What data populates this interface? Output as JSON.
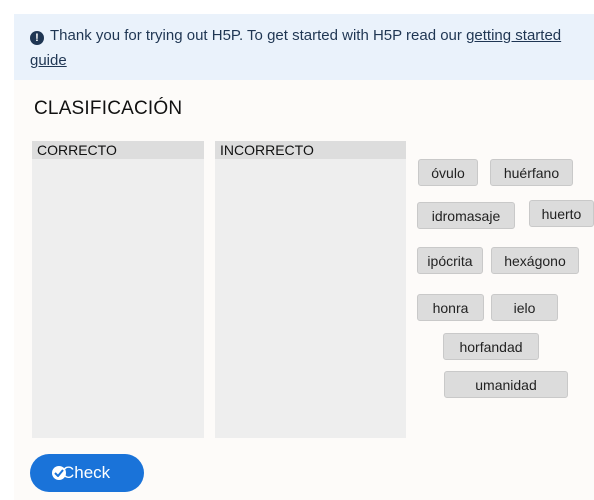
{
  "notice": {
    "text_before": "Thank you for trying out H5P. To get started with H5P read our ",
    "link_text": "getting started guide"
  },
  "task": {
    "title": "CLASIFICACIÓN",
    "zones": [
      "CORRECTO",
      "INCORRECTO"
    ],
    "draggables": [
      "óvulo",
      "huérfano",
      "idromasaje",
      "huerto",
      "ipócrita",
      "hexágono",
      "honra",
      "ielo",
      "horfandad",
      "umanidad"
    ]
  },
  "actions": {
    "check_label": "Check"
  },
  "colors": {
    "accent": "#1a73d9",
    "notice_bg": "#eaf2fb"
  }
}
